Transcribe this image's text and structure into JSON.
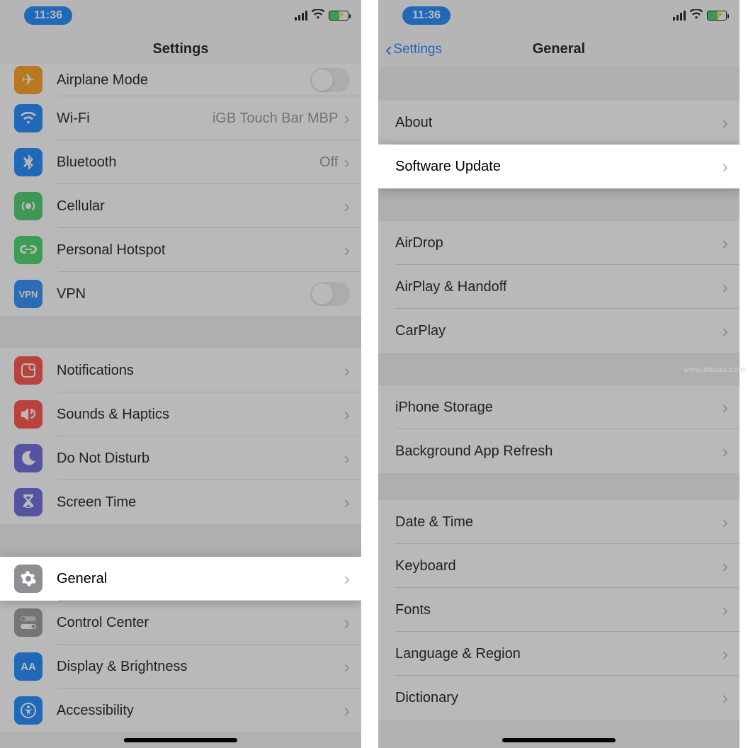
{
  "status": {
    "time": "11:36"
  },
  "left": {
    "title": "Settings",
    "rows": {
      "airplane": {
        "label": "Airplane Mode",
        "icon": "airplane-icon"
      },
      "wifi": {
        "label": "Wi-Fi",
        "detail": "iGB Touch Bar MBP",
        "icon": "wifi-icon"
      },
      "bluetooth": {
        "label": "Bluetooth",
        "detail": "Off",
        "icon": "bluetooth-icon"
      },
      "cellular": {
        "label": "Cellular",
        "icon": "cellular-icon"
      },
      "hotspot": {
        "label": "Personal Hotspot",
        "icon": "hotspot-icon"
      },
      "vpn": {
        "label": "VPN",
        "icon": "vpn-icon",
        "iconText": "VPN"
      },
      "notifications": {
        "label": "Notifications",
        "icon": "notifications-icon"
      },
      "sounds": {
        "label": "Sounds & Haptics",
        "icon": "sounds-icon"
      },
      "dnd": {
        "label": "Do Not Disturb",
        "icon": "moon-icon"
      },
      "screentime": {
        "label": "Screen Time",
        "icon": "hourglass-icon"
      },
      "general": {
        "label": "General",
        "icon": "gear-icon"
      },
      "control": {
        "label": "Control Center",
        "icon": "toggles-icon"
      },
      "display": {
        "label": "Display & Brightness",
        "icon": "text-size-icon",
        "iconText": "AA"
      },
      "accessibility": {
        "label": "Accessibility",
        "icon": "accessibility-icon"
      }
    }
  },
  "right": {
    "back": "Settings",
    "title": "General",
    "rows": {
      "about": {
        "label": "About"
      },
      "update": {
        "label": "Software Update"
      },
      "airdrop": {
        "label": "AirDrop"
      },
      "airplay": {
        "label": "AirPlay & Handoff"
      },
      "carplay": {
        "label": "CarPlay"
      },
      "storage": {
        "label": "iPhone Storage"
      },
      "refresh": {
        "label": "Background App Refresh"
      },
      "datetime": {
        "label": "Date & Time"
      },
      "keyboard": {
        "label": "Keyboard"
      },
      "fonts": {
        "label": "Fonts"
      },
      "lang": {
        "label": "Language & Region"
      },
      "dict": {
        "label": "Dictionary"
      }
    }
  },
  "watermark": "www.deuaq.com"
}
